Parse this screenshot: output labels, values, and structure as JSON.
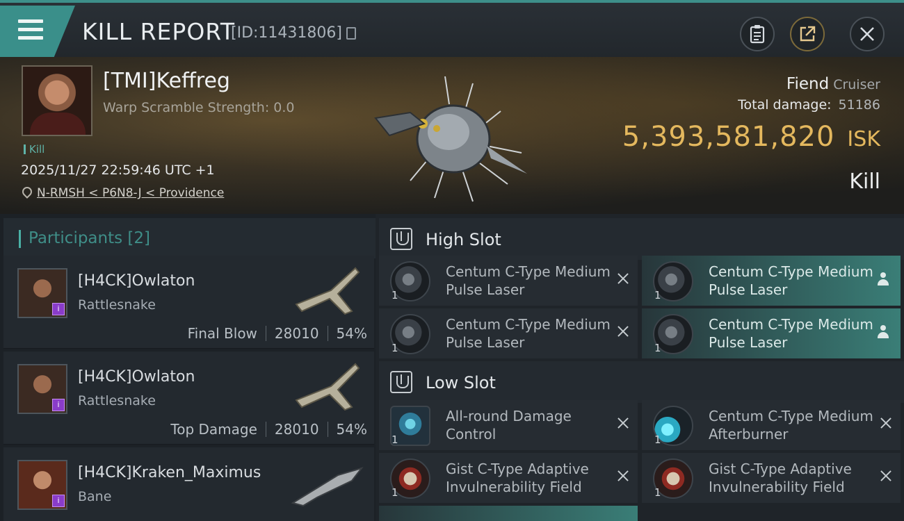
{
  "header": {
    "title": "KILL REPORT",
    "report_id": "[ID:11431806]",
    "buttons": [
      "notes-icon",
      "share-icon",
      "close-icon"
    ]
  },
  "victim": {
    "name": "[TMI]Keffreg",
    "warp_scramble": "Warp Scramble Strength: 0.0",
    "tag": "Kill",
    "datetime": "2025/11/27 22:59:46 UTC +1",
    "location": "N-RMSH < P6N8-J < Providence",
    "ship_name": "Fiend",
    "ship_class": "Cruiser",
    "total_damage_label": "Total damage:",
    "total_damage": "51186",
    "isk_value": "5,393,581,820",
    "isk_unit": "ISK",
    "result": "Kill"
  },
  "participants": {
    "title": "Participants [2]",
    "items": [
      {
        "name": "[H4CK]Owlaton",
        "ship": "Rattlesnake",
        "role": "Final Blow",
        "damage": "28010",
        "percent": "54%"
      },
      {
        "name": "[H4CK]Owlaton",
        "ship": "Rattlesnake",
        "role": "Top Damage",
        "damage": "28010",
        "percent": "54%"
      },
      {
        "name": "[H4CK]Kraken_Maximus",
        "ship": "Bane"
      }
    ]
  },
  "slots": {
    "high": {
      "label": "High Slot",
      "modules": [
        {
          "name": "Centum C-Type Medium Pulse Laser",
          "qty": "1",
          "state": "destroyed"
        },
        {
          "name": "Centum C-Type Medium Pulse Laser",
          "qty": "1",
          "state": "dropped"
        },
        {
          "name": "Centum C-Type Medium Pulse Laser",
          "qty": "1",
          "state": "destroyed"
        },
        {
          "name": "Centum C-Type Medium Pulse Laser",
          "qty": "1",
          "state": "dropped"
        }
      ]
    },
    "low": {
      "label": "Low Slot",
      "modules": [
        {
          "name": "All-round Damage Control",
          "qty": "1",
          "state": "destroyed"
        },
        {
          "name": "Centum C-Type Medium Afterburner",
          "qty": "1",
          "state": "destroyed"
        },
        {
          "name": "Gist C-Type Adaptive Invulnerability Field",
          "qty": "1",
          "state": "destroyed"
        },
        {
          "name": "Gist C-Type Adaptive Invulnerability Field",
          "qty": "1",
          "state": "destroyed"
        }
      ]
    }
  },
  "colors": {
    "accent": "#3a8f8a",
    "isk_gold": "#e4b85e",
    "badge_purple": "#8a3cc9"
  }
}
